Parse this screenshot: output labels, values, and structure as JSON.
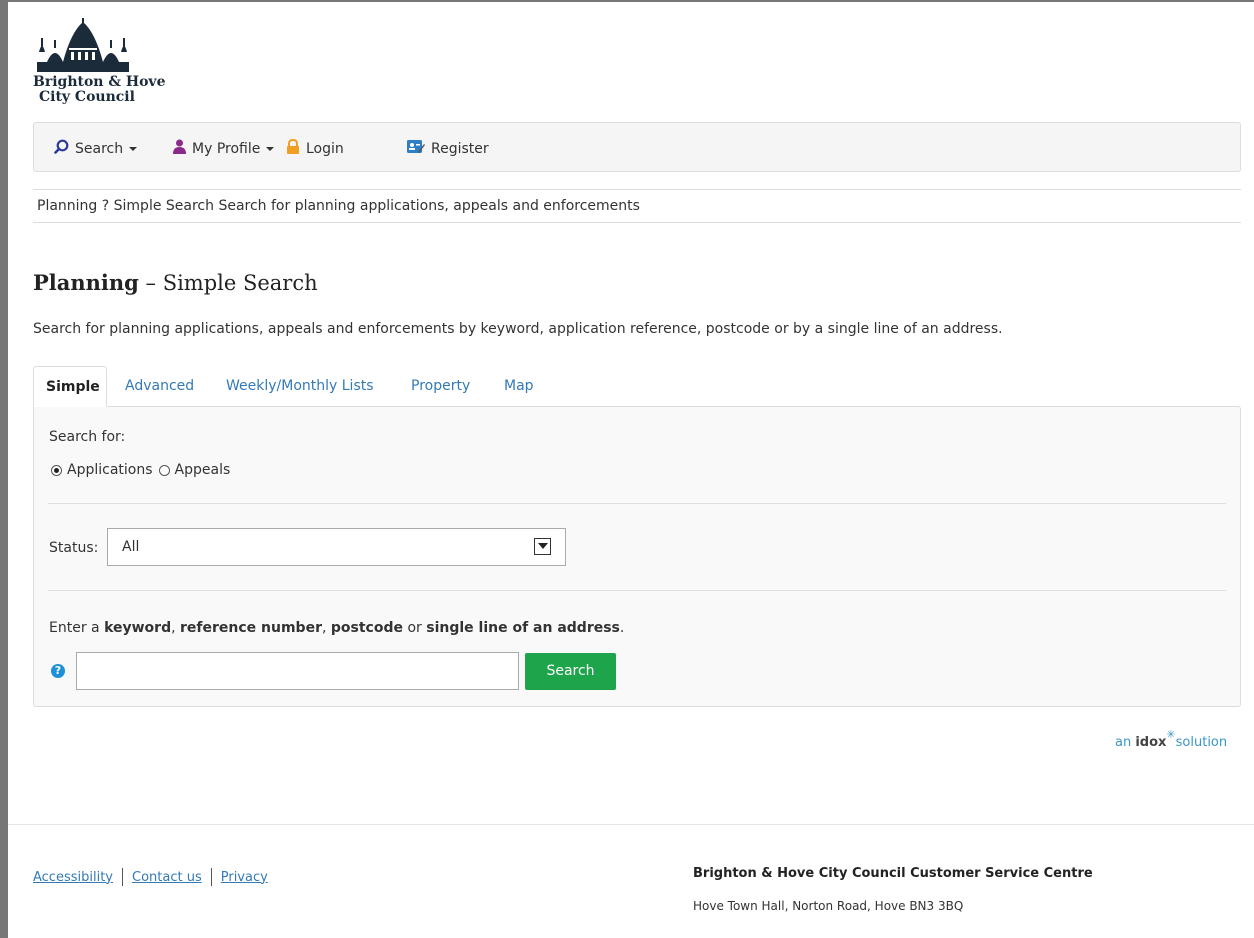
{
  "logo": {
    "line1": "Brighton & Hove",
    "line2": "City Council"
  },
  "nav": {
    "search_label": "Search",
    "profile_label": "My Profile",
    "login_label": "Login",
    "register_label": "Register"
  },
  "breadcrumb": "Planning ? Simple Search Search for planning applications, appeals and enforcements",
  "page": {
    "title_bold": "Planning",
    "title_rest": " – Simple Search",
    "intro": "Search for planning applications, appeals and enforcements by keyword, application reference, postcode or by a single line of an address."
  },
  "tabs": [
    {
      "label": "Simple",
      "active": true
    },
    {
      "label": "Advanced"
    },
    {
      "label": "Weekly/Monthly Lists"
    },
    {
      "label": "Property"
    },
    {
      "label": "Map"
    }
  ],
  "form": {
    "search_for_label": "Search for:",
    "radio_applications": "Applications",
    "radio_appeals": "Appeals",
    "selected_radio": "Applications",
    "status_label": "Status:",
    "status_value": "All",
    "instruction_pre": "Enter a ",
    "instruction_kw": "keyword",
    "instruction_sep1": ", ",
    "instruction_ref": "reference number",
    "instruction_sep2": ", ",
    "instruction_pc": "postcode",
    "instruction_or": " or ",
    "instruction_addr": "single line of an address",
    "instruction_end": ".",
    "search_value": "",
    "search_button": "Search",
    "help_glyph": "?"
  },
  "idox": {
    "pre": "an ",
    "brand": "idox",
    "post": "solution"
  },
  "footer": {
    "accessibility": "Accessibility",
    "contact": "Contact us",
    "privacy": "Privacy",
    "centre_title": "Brighton & Hove City Council Customer Service Centre",
    "centre_address": "Hove Town Hall, Norton Road, Hove BN3 3BQ"
  },
  "colors": {
    "link": "#337ab7",
    "search_button": "#1ea54b",
    "help_icon": "#1e90d8",
    "profile_icon": "#8a2a8a",
    "login_icon": "#f0a020"
  }
}
